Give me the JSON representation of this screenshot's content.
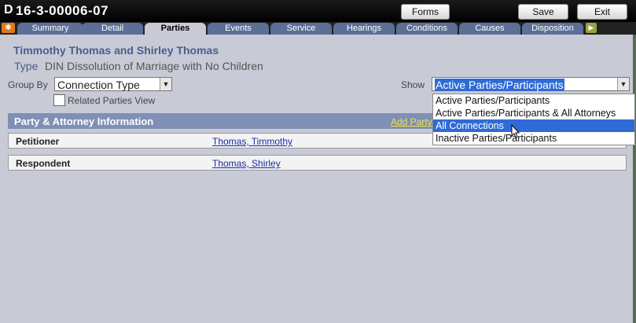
{
  "window": {
    "case_number": "16-3-00006-07",
    "buttons": {
      "forms": "Forms",
      "save": "Save",
      "exit": "Exit"
    }
  },
  "tabs": [
    {
      "label": "Summary"
    },
    {
      "label": "Detail"
    },
    {
      "label": "Parties",
      "active": true
    },
    {
      "label": "Events"
    },
    {
      "label": "Service"
    },
    {
      "label": "Hearings"
    },
    {
      "label": "Conditions"
    },
    {
      "label": "Causes"
    },
    {
      "label": "Disposition"
    }
  ],
  "case": {
    "title": "Timmothy Thomas and Shirley Thomas",
    "type_label": "Type",
    "type_value": "DIN Dissolution of Marriage with No Children"
  },
  "filters": {
    "group_by_label": "Group By",
    "group_by_value": "Connection Type",
    "related_parties_label": "Related Parties View",
    "show_label": "Show",
    "show_value": "Active Parties/Participants",
    "show_options": [
      "Active Parties/Participants",
      "Active Parties/Participants & All Attorneys",
      "All Connections",
      "Inactive Parties/Participants"
    ],
    "highlighted_option_index": 2
  },
  "party_section": {
    "title": "Party & Attorney Information",
    "add_link": "Add Party",
    "rows": [
      {
        "role": "Petitioner",
        "name": "Thomas, Timmothy"
      },
      {
        "role": "Respondent",
        "name": "Thomas, Shirley"
      }
    ]
  },
  "colors": {
    "accent": "#4a5e8c",
    "tab_inactive": "#5b6f97",
    "tab_active": "#c8cbd6",
    "section_header": "#7f8fb6",
    "selection": "#2f6bd6"
  }
}
